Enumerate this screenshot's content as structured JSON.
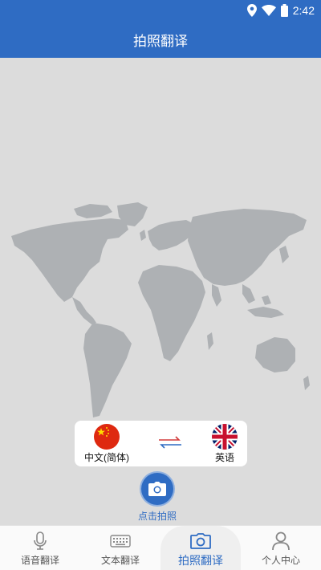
{
  "status": {
    "time": "2:42"
  },
  "header": {
    "title": "拍照翻译"
  },
  "languages": {
    "source": "中文(简体)",
    "target": "英语"
  },
  "capture": {
    "label": "点击拍照"
  },
  "nav": [
    {
      "label": "语音翻译",
      "icon": "microphone-icon",
      "active": false
    },
    {
      "label": "文本翻译",
      "icon": "keyboard-icon",
      "active": false
    },
    {
      "label": "拍照翻译",
      "icon": "camera-icon",
      "active": true
    },
    {
      "label": "个人中心",
      "icon": "person-icon",
      "active": false
    }
  ],
  "colors": {
    "primary": "#2f6cc3",
    "background": "#dcdcdc",
    "map": "#aeb1b4"
  }
}
